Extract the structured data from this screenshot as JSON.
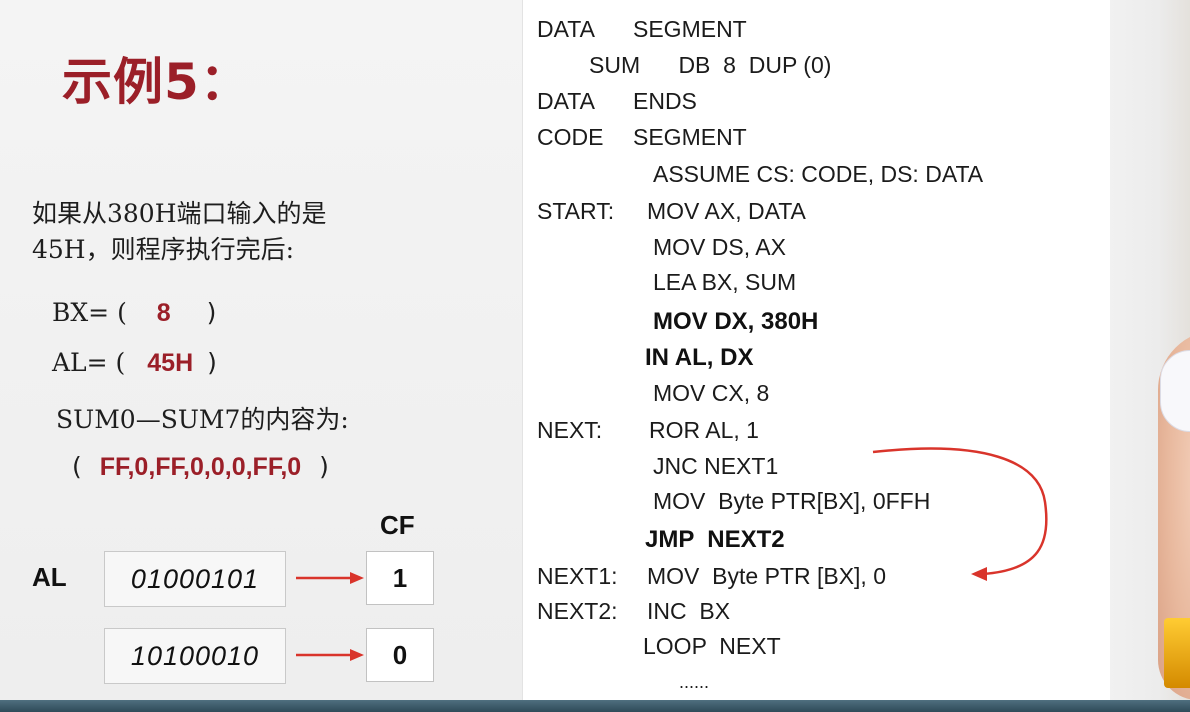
{
  "title": "示例5：",
  "question": {
    "lines": [
      "如果从380H端口输入的是",
      "45H，则程序执行完后:"
    ],
    "bx": {
      "prefix": "BX= (",
      "value": "8",
      "suffix": ")"
    },
    "al": {
      "prefix": "AL= (",
      "value": "45H",
      "suffix": ")"
    },
    "sum_label": "SUM0—SUM7的内容为:",
    "sum": {
      "prefix": "(",
      "value": "FF,0,FF,0,0,0,FF,0",
      "suffix": ")"
    }
  },
  "diagram": {
    "cf_label": "CF",
    "al_label": "AL",
    "rows": [
      {
        "binary": "01000101",
        "cf": "1"
      },
      {
        "binary": "10100010",
        "cf": "0"
      }
    ],
    "arrow_color": "#d9342b"
  },
  "code": {
    "lines": [
      {
        "label": "DATA",
        "text": "SEGMENT"
      },
      {
        "label": "",
        "text": "SUM      DB  8  DUP (0)"
      },
      {
        "label": "DATA",
        "text": "ENDS"
      },
      {
        "label": "CODE",
        "text": "SEGMENT"
      },
      {
        "label": "",
        "text": "ASSUME CS: CODE, DS: DATA"
      },
      {
        "label": "START:",
        "text": "MOV AX, DATA"
      },
      {
        "label": "",
        "text": "MOV DS, AX"
      },
      {
        "label": "",
        "text": "LEA BX, SUM"
      },
      {
        "label": "",
        "text": "MOV DX, 380H"
      },
      {
        "label": "",
        "text": "IN AL, DX"
      },
      {
        "label": "",
        "text": "MOV CX, 8"
      },
      {
        "label": "NEXT:",
        "text": "ROR AL, 1"
      },
      {
        "label": "",
        "text": "JNC NEXT1"
      },
      {
        "label": "",
        "text": "MOV  Byte PTR[BX], 0FFH"
      },
      {
        "label": "",
        "text": "JMP  NEXT2"
      },
      {
        "label": "NEXT1:",
        "text": "MOV  Byte PTR [BX], 0"
      },
      {
        "label": "NEXT2:",
        "text": "INC  BX"
      },
      {
        "label": "",
        "text": "LOOP  NEXT"
      },
      {
        "label": "",
        "text": "......"
      }
    ]
  },
  "colors": {
    "title": "#9b1f28",
    "answer": "#9b1f28",
    "arrow": "#d9342b",
    "jump_arrow": "#d9342b"
  }
}
